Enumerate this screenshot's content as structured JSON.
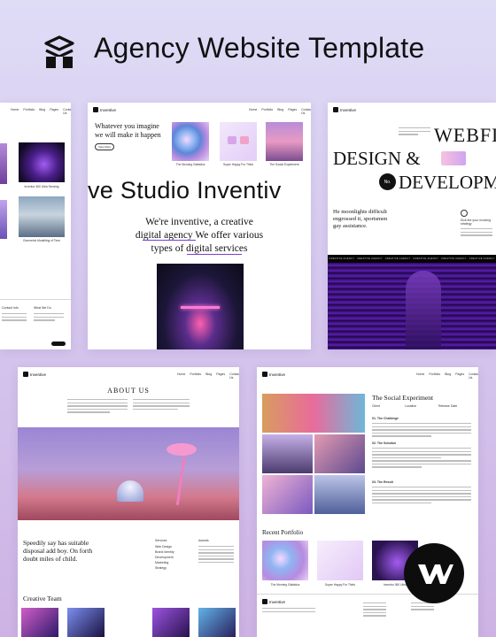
{
  "header": {
    "title": "Agency Website Template",
    "logo_icon": "stacked-layers-icon"
  },
  "card_left_top": {
    "nav": [
      "Home",
      "Portfolio",
      "Blog",
      "Pages",
      "Contact Us"
    ],
    "captions": [
      "Inventor 360 Ultra Sensing",
      "Geometric Modelling of Time"
    ],
    "footer_headings": [
      "Contact Info",
      "What We Do"
    ]
  },
  "card_mid_top": {
    "brand": "Inventive",
    "nav": [
      "Home",
      "Portfolio",
      "Blog",
      "Pages",
      "Contact Us"
    ],
    "hero_heading": "Whatever you imagine we will make it happen",
    "hero_button": "View More",
    "thumb_captions": [
      "The Morning Glatistics",
      "Super Happy For Think",
      "The Social Experiment"
    ],
    "marquee": "ve Studio Inventiv",
    "intro_line1": "We're inventive, a creative",
    "intro_line2": "digital agency We offer various",
    "intro_line3": "types of digital services"
  },
  "card_right_top": {
    "brand": "Inventive",
    "webf": "WEBFL",
    "design": "DESIGN &",
    "develop": "DEVELOPM",
    "badge": "No.",
    "tagline": "He moonlights difficult engrossed it, sportsmen gay assistance.",
    "side_title": "Kick the your evolving strategy",
    "stripe_items": [
      "CREATIVE AGENCY",
      "CREATIVE AGENCY",
      "CREATIVE AGENCY",
      "CREATIVE AGENCY",
      "CREATIVE AGENCY",
      "CREATIVE AGENCY"
    ]
  },
  "card_left_bottom": {
    "brand": "Inventive",
    "nav": [
      "Home",
      "Portfolio",
      "Blog",
      "Pages",
      "Contact Us"
    ],
    "heading": "ABOUT US",
    "tagline_lines": [
      "Speedily say has suitable",
      "disposal add boy. On forth",
      "doubt miles of child."
    ],
    "col1_title": "Services",
    "col1_items": [
      "Web Design",
      "Brand Identity",
      "Development",
      "Marketing",
      "Strategy"
    ],
    "col2_title": "Awards",
    "creative_team": "Creative Team"
  },
  "card_right_bottom": {
    "brand": "Inventive",
    "nav": [
      "Home",
      "Portfolio",
      "Blog",
      "Pages",
      "Contact Us"
    ],
    "project_title": "The Social Experiment",
    "meta_labels": [
      "Client",
      "Location",
      "Release Date"
    ],
    "sections": [
      "01. The Challenge",
      "02. The Solution",
      "03. The Result"
    ],
    "recent": "Recent Portfolio",
    "thumb_captions": [
      "The Morning Glatistics",
      "Super Happy For Think",
      "Inventor 360 Ultra"
    ]
  },
  "brand_badge_icon": "webflow-w-icon",
  "colors": {
    "background_top": "#dfdcf6",
    "background_bottom": "#cdb3e4",
    "accent_purple": "#7b3fd1",
    "dark": "#0d0d0d"
  }
}
